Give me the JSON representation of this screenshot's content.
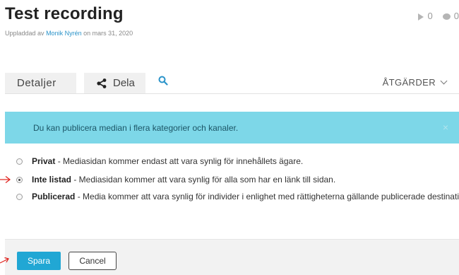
{
  "header": {
    "title": "Test recording",
    "meta_prefix": "Uppladdad av",
    "author": "Monik Nyrén",
    "meta_suffix": "on mars 31, 2020",
    "plays": "0",
    "comments": "0"
  },
  "tabs": {
    "details": "Detaljer",
    "share": "Dela",
    "actions": "ÅTGÄRDER"
  },
  "alert": {
    "text": "Du kan publicera median i flera kategorier och kanaler.",
    "close": "×"
  },
  "options": [
    {
      "label": "Privat",
      "desc": " - Mediasidan kommer endast att vara synlig för innehållets ägare.",
      "selected": false
    },
    {
      "label": "Inte listad",
      "desc": " - Mediasidan kommer att vara synlig för alla som har en länk till sidan.",
      "selected": true
    },
    {
      "label": "Publicerad",
      "desc": " - Media kommer att vara synlig för individer i enlighet med rättigheterna gällande publicerade destinationer",
      "selected": false
    }
  ],
  "buttons": {
    "save": "Spara",
    "cancel": "Cancel"
  },
  "colors": {
    "accent": "#21a7d4",
    "alert_bg": "#7dd7e8",
    "annotation_arrow": "#e0201b"
  }
}
